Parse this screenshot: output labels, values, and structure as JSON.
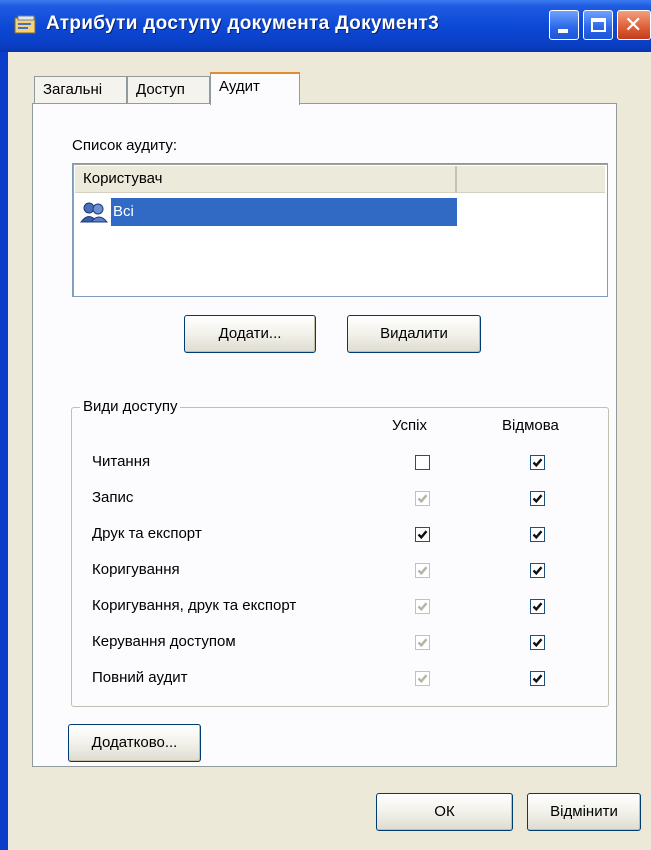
{
  "window": {
    "title": "Атрибути доступу документа Документ3",
    "close_glyph": "✕"
  },
  "tabs": [
    {
      "label": "Загальні"
    },
    {
      "label": "Доступ"
    },
    {
      "label": "Аудит",
      "active": true
    }
  ],
  "audit_list": {
    "label": "Список аудиту:",
    "column_header": "Користувач",
    "items": [
      {
        "name": "Всі",
        "icon": "users-group-icon",
        "selected": true
      }
    ]
  },
  "buttons": {
    "add": "Додати...",
    "remove": "Видалити",
    "advanced": "Додатково...",
    "ok": "ОК",
    "cancel": "Відмінити"
  },
  "access_types": {
    "title": "Види доступу",
    "col_success": "Успіх",
    "col_failure": "Відмова",
    "rows": [
      {
        "label": "Читання",
        "success": false,
        "success_disabled": false,
        "failure": true
      },
      {
        "label": "Запис",
        "success": true,
        "success_disabled": true,
        "failure": true
      },
      {
        "label": "Друк та експорт",
        "success": true,
        "success_disabled": false,
        "failure": true
      },
      {
        "label": "Коригування",
        "success": true,
        "success_disabled": true,
        "failure": true
      },
      {
        "label": "Коригування, друк та експорт",
        "success": true,
        "success_disabled": true,
        "failure": true
      },
      {
        "label": "Керування доступом",
        "success": true,
        "success_disabled": true,
        "failure": true
      },
      {
        "label": "Повний аудит",
        "success": true,
        "success_disabled": true,
        "failure": true
      }
    ]
  },
  "colors": {
    "titlebar": "#0c49d6",
    "selection": "#316ac5",
    "dialog_bg": "#ece9d8"
  }
}
